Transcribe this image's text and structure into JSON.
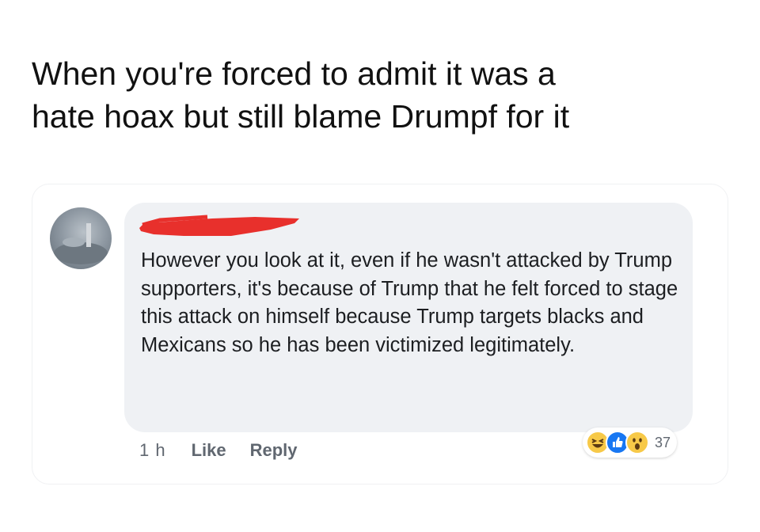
{
  "caption": {
    "line1": "When you're forced to admit it was a",
    "line2": "hate hoax but still blame Drumpf for it"
  },
  "comment": {
    "author_redacted": true,
    "text": "However you look at it, even if he wasn't attacked by Trump supporters, it's because of Trump that he felt forced to stage this attack on himself because Trump targets blacks and Mexicans so he has been victimized legitimately.",
    "time": "1 h",
    "like_label": "Like",
    "reply_label": "Reply",
    "reactions": {
      "icons": [
        "haha-icon",
        "like-icon",
        "wow-icon"
      ],
      "count": "37"
    }
  },
  "colors": {
    "bubble": "#eff1f4",
    "redaction": "#e8302c",
    "like_blue": "#1877f2",
    "emoji_yellow": "#f7c948"
  }
}
